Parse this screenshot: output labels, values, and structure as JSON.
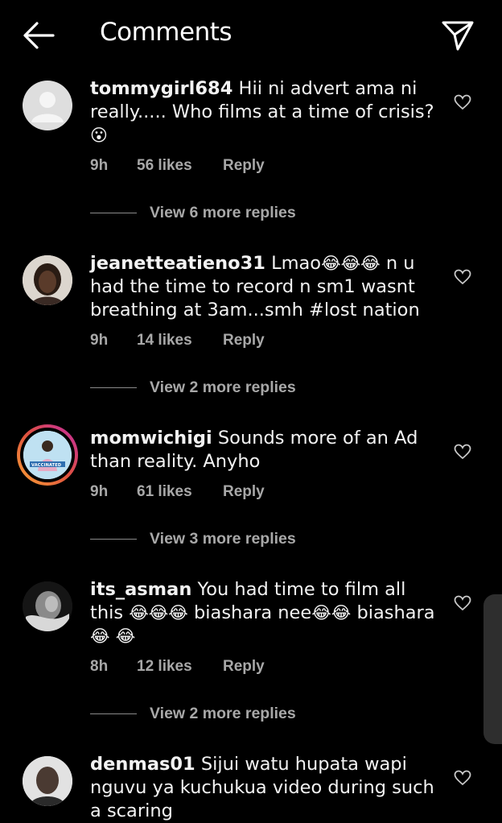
{
  "header": {
    "title": "Comments",
    "back_icon": "arrow-left-icon",
    "send_icon": "send-icon"
  },
  "comments": [
    {
      "username": "tommygirl684",
      "text": "Hii ni advert ama ni really..... Who films at a time of crisis?",
      "emoji": "😮",
      "time": "9h",
      "likes": "56 likes",
      "reply": "Reply",
      "view_replies": "View 6 more replies"
    },
    {
      "username": "jeanetteatieno31",
      "text_before": "Lmao",
      "emoji": "😂😂😂",
      "text_after": " n u had the time to record n sm1 wasnt breathing at 3am...smh #lost nation",
      "time": "9h",
      "likes": "14 likes",
      "reply": "Reply",
      "view_replies": "View 2 more replies"
    },
    {
      "username": "momwichigi",
      "text": "Sounds more of an Ad than reality. Anyho",
      "avatar_badge": "VACCINATED",
      "time": "9h",
      "likes": "61 likes",
      "reply": "Reply",
      "view_replies": "View 3 more replies"
    },
    {
      "username": "its_asman",
      "text_before": "You had time to film all this",
      "emoji_a": "😂😂😂",
      "mid_a": " biashara nee",
      "emoji_b": "😂😂",
      "mid_b": " biashara ",
      "emoji_c": "😂",
      "emoji_d": "😂",
      "time": "8h",
      "likes": "12 likes",
      "reply": "Reply",
      "view_replies": "View 2 more replies"
    },
    {
      "username": "denmas01",
      "text": "Sijui watu hupata wapi nguvu ya kuchukua video during such a scaring"
    }
  ],
  "colors": {
    "background": "#000000",
    "secondary_text": "#a8a8a8",
    "story_ring_start": "#f9a334",
    "story_ring_end": "#c22aa3"
  }
}
